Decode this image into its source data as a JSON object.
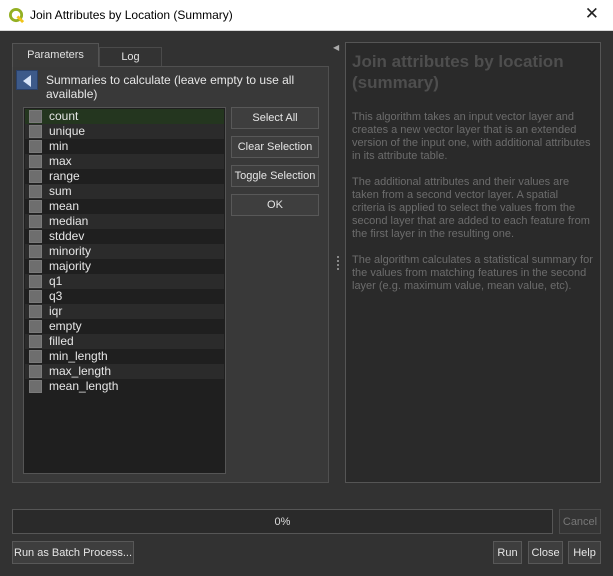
{
  "window": {
    "title": "Join Attributes by Location (Summary)",
    "close_glyph": "✕"
  },
  "tabs": [
    {
      "label": "Parameters",
      "active": true
    },
    {
      "label": "Log",
      "active": false
    }
  ],
  "parameters": {
    "section_label": "Summaries to calculate (leave empty to use all available)",
    "summaries": [
      {
        "label": "count",
        "checked": false
      },
      {
        "label": "unique",
        "checked": false
      },
      {
        "label": "min",
        "checked": false
      },
      {
        "label": "max",
        "checked": false
      },
      {
        "label": "range",
        "checked": false
      },
      {
        "label": "sum",
        "checked": false
      },
      {
        "label": "mean",
        "checked": false
      },
      {
        "label": "median",
        "checked": false
      },
      {
        "label": "stddev",
        "checked": false
      },
      {
        "label": "minority",
        "checked": false
      },
      {
        "label": "majority",
        "checked": false
      },
      {
        "label": "q1",
        "checked": false
      },
      {
        "label": "q3",
        "checked": false
      },
      {
        "label": "iqr",
        "checked": false
      },
      {
        "label": "empty",
        "checked": false
      },
      {
        "label": "filled",
        "checked": false
      },
      {
        "label": "min_length",
        "checked": false
      },
      {
        "label": "max_length",
        "checked": false
      },
      {
        "label": "mean_length",
        "checked": false
      }
    ],
    "buttons": {
      "select_all": "Select All",
      "clear_selection": "Clear Selection",
      "toggle_selection": "Toggle Selection",
      "ok": "OK"
    }
  },
  "help": {
    "title": "Join attributes by location (summary)",
    "paragraphs": [
      "This algorithm takes an input vector layer and creates a new vector layer that is an extended version of the input one, with additional attributes in its attribute table.",
      "The additional attributes and their values are taken from a second vector layer. A spatial criteria is applied to select the values from the second layer that are added to each feature from the first layer in the resulting one.",
      "The algorithm calculates a statistical summary for the values from matching features in the second layer (e.g. maximum value, mean value, etc)."
    ]
  },
  "progress": {
    "text": "0%",
    "value": 0
  },
  "footer": {
    "cancel": "Cancel",
    "batch": "Run as Batch Process...",
    "run": "Run",
    "close": "Close",
    "help": "Help"
  },
  "colors": {
    "accent": "#3d5a8a",
    "qgis_green": "#93b023",
    "qgis_yellow": "#f0c419"
  }
}
